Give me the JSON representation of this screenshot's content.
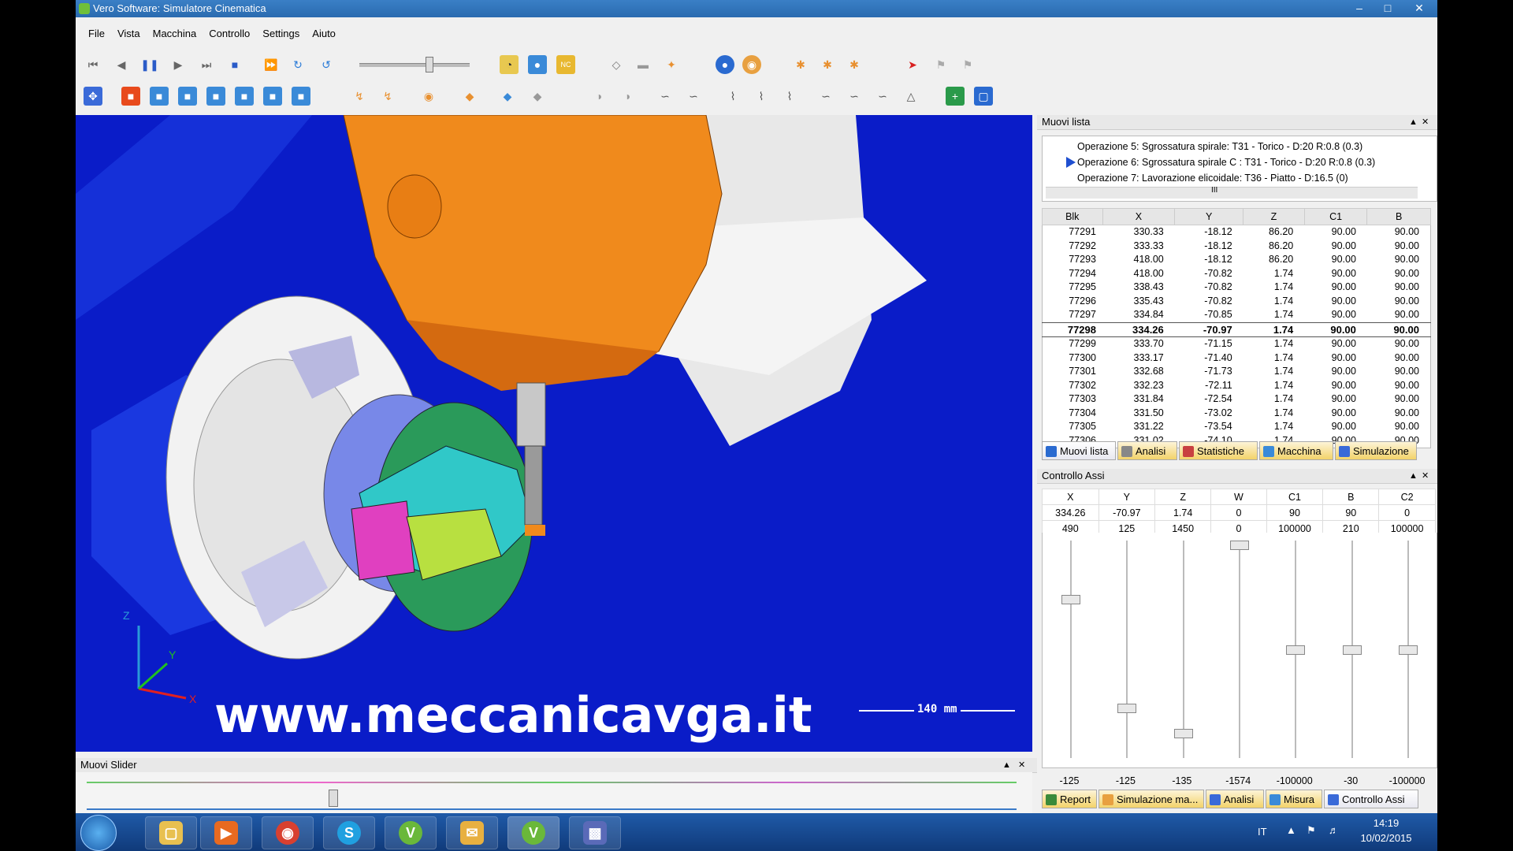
{
  "window": {
    "title": "Vero Software: Simulatore Cinematica"
  },
  "menu": [
    "File",
    "Vista",
    "Macchina",
    "Controllo",
    "Settings",
    "Aiuto"
  ],
  "viewport": {
    "watermark": "www.meccanicavga.it",
    "scale": "140 mm",
    "axis_x": "X",
    "axis_y": "Y",
    "axis_z": "Z"
  },
  "muovi_lista": {
    "title": "Muovi lista",
    "operations": [
      "Operazione 5: Sgrossatura spirale: T31 - Torico - D:20 R:0.8 (0.3)",
      "Operazione 6: Sgrossatura spirale C : T31 - Torico - D:20 R:0.8 (0.3)",
      "Operazione 7: Lavorazione elicoidale: T36 - Piatto - D:16.5 (0)"
    ],
    "scroll_mark": "III",
    "columns": [
      "Blk",
      "X",
      "Y",
      "Z",
      "C1",
      "B"
    ],
    "rows": [
      [
        "77291",
        "330.33",
        "-18.12",
        "86.20",
        "90.00",
        "90.00"
      ],
      [
        "77292",
        "333.33",
        "-18.12",
        "86.20",
        "90.00",
        "90.00"
      ],
      [
        "77293",
        "418.00",
        "-18.12",
        "86.20",
        "90.00",
        "90.00"
      ],
      [
        "77294",
        "418.00",
        "-70.82",
        "1.74",
        "90.00",
        "90.00"
      ],
      [
        "77295",
        "338.43",
        "-70.82",
        "1.74",
        "90.00",
        "90.00"
      ],
      [
        "77296",
        "335.43",
        "-70.82",
        "1.74",
        "90.00",
        "90.00"
      ],
      [
        "77297",
        "334.84",
        "-70.85",
        "1.74",
        "90.00",
        "90.00"
      ],
      [
        "77298",
        "334.26",
        "-70.97",
        "1.74",
        "90.00",
        "90.00"
      ],
      [
        "77299",
        "333.70",
        "-71.15",
        "1.74",
        "90.00",
        "90.00"
      ],
      [
        "77300",
        "333.17",
        "-71.40",
        "1.74",
        "90.00",
        "90.00"
      ],
      [
        "77301",
        "332.68",
        "-71.73",
        "1.74",
        "90.00",
        "90.00"
      ],
      [
        "77302",
        "332.23",
        "-72.11",
        "1.74",
        "90.00",
        "90.00"
      ],
      [
        "77303",
        "331.84",
        "-72.54",
        "1.74",
        "90.00",
        "90.00"
      ],
      [
        "77304",
        "331.50",
        "-73.02",
        "1.74",
        "90.00",
        "90.00"
      ],
      [
        "77305",
        "331.22",
        "-73.54",
        "1.74",
        "90.00",
        "90.00"
      ],
      [
        "77306",
        "331.02",
        "-74.10",
        "1.74",
        "90.00",
        "90.00"
      ]
    ],
    "current_row": 7,
    "tabs": [
      "Muovi lista",
      "Analisi",
      "Statistiche",
      "Macchina",
      "Simulazione"
    ]
  },
  "controllo_assi": {
    "title": "Controllo Assi",
    "columns": [
      "X",
      "Y",
      "Z",
      "W",
      "C1",
      "B",
      "C2"
    ],
    "current": [
      "334.26",
      "-70.97",
      "1.74",
      "0",
      "90",
      "90",
      "0"
    ],
    "max": [
      "490",
      "125",
      "1450",
      "0",
      "100000",
      "210",
      "100000"
    ],
    "min": [
      "-125",
      "-125",
      "-135",
      "-1574",
      "-100000",
      "-30",
      "-100000"
    ],
    "slider_level": [
      0.26,
      0.78,
      0.9,
      0.0,
      0.5,
      0.5,
      0.5
    ],
    "tabs": [
      "Report",
      "Simulazione ma...",
      "Analisi",
      "Misura",
      "Controllo Assi"
    ]
  },
  "muovi_slider": {
    "title": "Muovi Slider",
    "position": 0.26
  },
  "taskbar": {
    "lang": "IT",
    "time": "14:19",
    "date": "10/02/2015"
  },
  "colors": {
    "viewport_bg": "#0a1cc8",
    "spindle": "#f08a1c",
    "tab_active": "#f3d36a"
  }
}
